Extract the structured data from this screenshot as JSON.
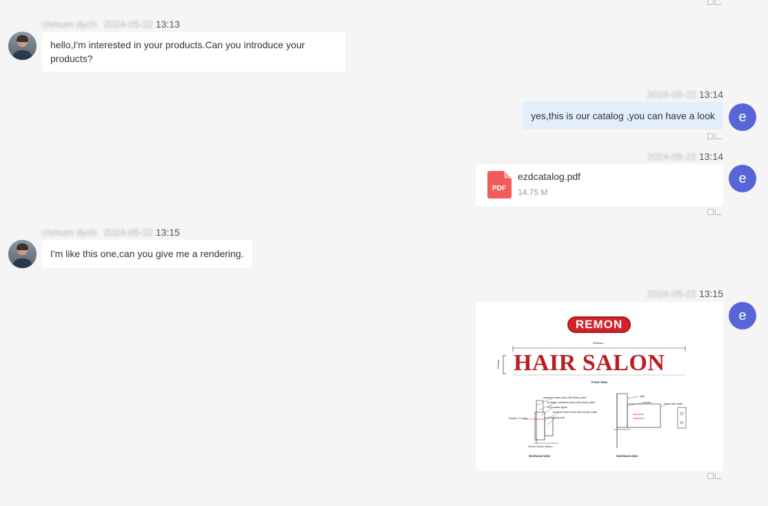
{
  "messages": [
    {
      "sender": "chmum dych",
      "date": "2024-05-22",
      "time": "13:13",
      "text": "hello,I'm interested in your products.Can you introduce your products?"
    },
    {
      "date": "2024-05-22",
      "time": "13:14",
      "text": "yes,this is our catalog ,you can have a look"
    },
    {
      "date": "2024-05-22",
      "time": "13:14",
      "file": {
        "name": "ezdcatalog.pdf",
        "size": "14.75 M",
        "icon_label": "PDF"
      }
    },
    {
      "sender": "chmum dych",
      "date": "2024-05-22",
      "time": "13:15",
      "text": "I'm like this one,can you give me a rendering."
    },
    {
      "date": "2024-05-22",
      "time": "13:15",
      "image": {
        "brand": "REMON",
        "sign_text": "HAIR SALON",
        "dimension_top": "2050mm",
        "dimension_side": "370mm",
        "front_view": "Front View",
        "sectional_view_1": "Sectional view",
        "sectional_view_2": "Sectional view",
        "note_1": "stainless steel strip with black paint",
        "note_2": "brushed stainless steel with black paint",
        "note_3": "LED white lights",
        "note_4": "brushed steel back with acrylic plate",
        "note_5": "fixing bolt",
        "note_6": "Acrylic +1.5mm",
        "note_7": "20mm 50mm 80mm",
        "note_8": "wall",
        "note_9": "screws",
        "note_10": "fixed with bolts"
      }
    }
  ],
  "agent_avatar_letter": "e",
  "colors": {
    "background": "#f5f5f5",
    "outgoing_bubble": "#e3eefc",
    "agent_avatar": "#5865d6",
    "pdf_red": "#f25b5b",
    "sign_red": "#b81e24"
  }
}
